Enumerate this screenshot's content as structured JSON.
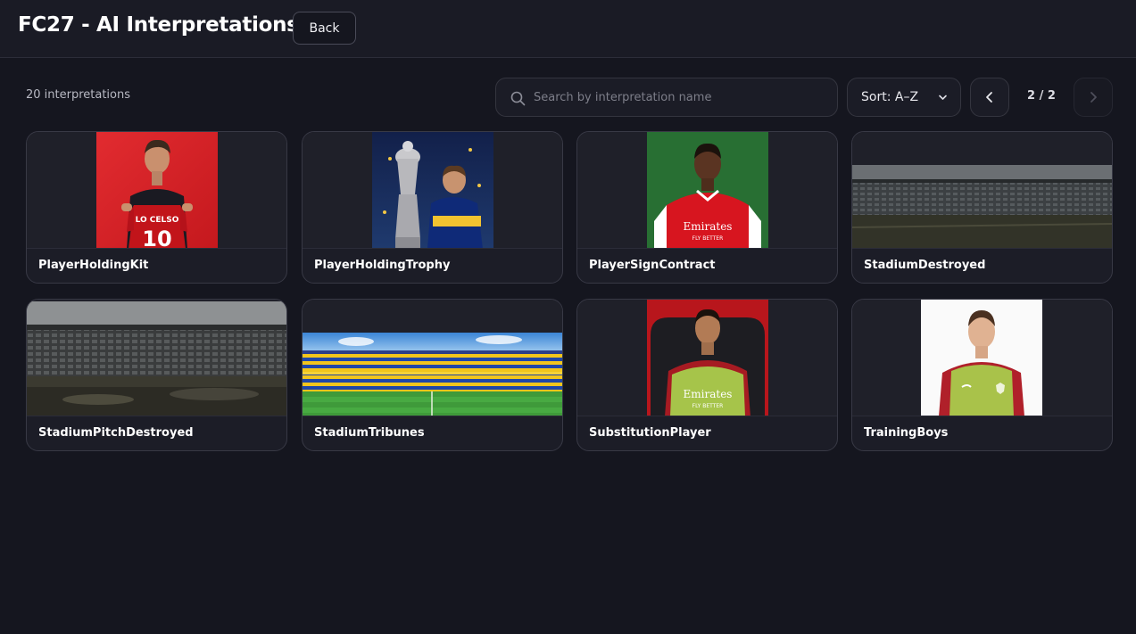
{
  "header": {
    "title": "FC27 - AI Interpretations",
    "back_label": "Back"
  },
  "toolbar": {
    "count_text": "20 interpretations",
    "search_placeholder": "Search by interpretation name",
    "search_value": "",
    "sort_label": "Sort: A–Z",
    "page_indicator": "2 / 2"
  },
  "cards": [
    {
      "label": "PlayerHoldingKit",
      "kit_text": "LO CELSO",
      "kit_number": "10"
    },
    {
      "label": "PlayerHoldingTrophy"
    },
    {
      "label": "PlayerSignContract",
      "sponsor": "Emirates",
      "sponsor_sub": "FLY BETTER"
    },
    {
      "label": "StadiumDestroyed"
    },
    {
      "label": "StadiumPitchDestroyed"
    },
    {
      "label": "StadiumTribunes"
    },
    {
      "label": "SubstitutionPlayer",
      "sponsor": "Emirates",
      "sponsor_sub": "FLY BETTER"
    },
    {
      "label": "TrainingBoys"
    }
  ],
  "colors": {
    "background": "#15161f",
    "card": "#1c1d27",
    "border": "#383945"
  }
}
